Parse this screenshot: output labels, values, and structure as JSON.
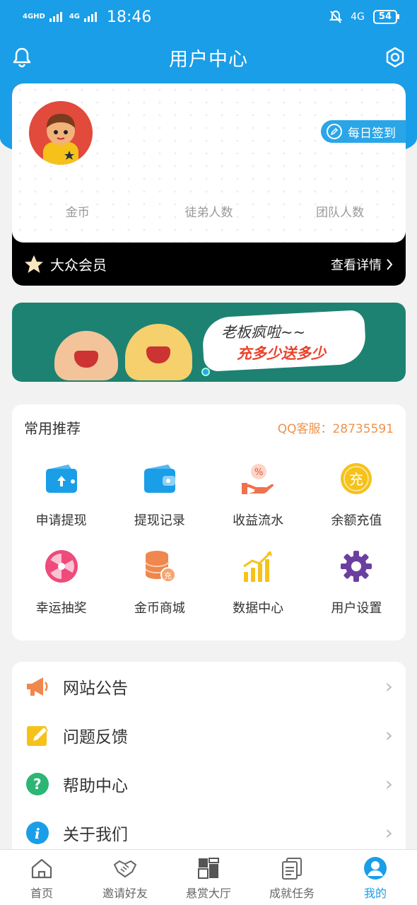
{
  "status_bar": {
    "signal1": "4GHD",
    "signal2": "4G",
    "time": "18:46",
    "network": "4G",
    "battery": "54"
  },
  "header": {
    "title": "用户中心"
  },
  "profile": {
    "sign_in_label": "每日签到",
    "stats": [
      "金币",
      "徒弟人数",
      "团队人数"
    ],
    "membership": "大众会员",
    "view_details": "查看详情"
  },
  "banner": {
    "line1": "老板疯啦~~",
    "line2": "充多少送多少"
  },
  "recommend": {
    "title": "常用推荐",
    "service": "QQ客服：28735591",
    "items": [
      {
        "label": "申请提现",
        "icon": "wallet-withdraw-icon"
      },
      {
        "label": "提现记录",
        "icon": "wallet-record-icon"
      },
      {
        "label": "收益流水",
        "icon": "income-hand-icon"
      },
      {
        "label": "余额充值",
        "icon": "recharge-coin-icon"
      },
      {
        "label": "幸运抽奖",
        "icon": "lottery-wheel-icon"
      },
      {
        "label": "金币商城",
        "icon": "coin-stack-icon"
      },
      {
        "label": "数据中心",
        "icon": "bar-chart-icon"
      },
      {
        "label": "用户设置",
        "icon": "gear-icon"
      }
    ]
  },
  "menu": [
    {
      "label": "网站公告",
      "icon": "megaphone-icon"
    },
    {
      "label": "问题反馈",
      "icon": "pencil-note-icon"
    },
    {
      "label": "帮助中心",
      "icon": "help-icon"
    },
    {
      "label": "关于我们",
      "icon": "info-icon"
    }
  ],
  "tabbar": [
    {
      "label": "首页",
      "icon": "home-icon"
    },
    {
      "label": "邀请好友",
      "icon": "handshake-icon"
    },
    {
      "label": "悬赏大厅",
      "icon": "grid-hall-icon"
    },
    {
      "label": "成就任务",
      "icon": "task-doc-icon"
    },
    {
      "label": "我的",
      "icon": "user-icon",
      "active": true
    }
  ],
  "colors": {
    "primary": "#1a9ee8",
    "accent_orange": "#f0924b",
    "vip_bar": "#000000"
  }
}
